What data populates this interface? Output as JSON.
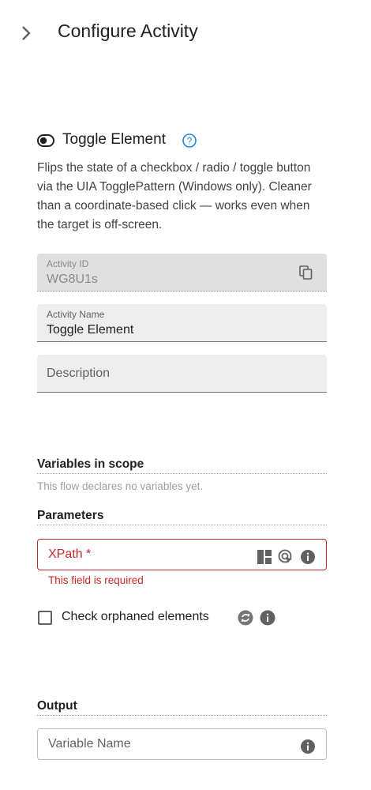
{
  "header": {
    "title": "Configure Activity",
    "expand_icon": "chevron-right-icon"
  },
  "activity": {
    "icon": "toggle-icon",
    "name": "Toggle Element",
    "help_icon": "help-circle-icon",
    "description": "Flips the state of a checkbox / radio / toggle button via the UIA TogglePattern (Windows only). Cleaner than a coordinate-based click — works even when the target is off-screen."
  },
  "fields": {
    "activity_id": {
      "label": "Activity ID",
      "value": "WG8U1s",
      "icon": "copy-icon"
    },
    "activity_name": {
      "label": "Activity Name",
      "value": "Toggle Element"
    },
    "description": {
      "placeholder": "Description"
    }
  },
  "variables": {
    "heading": "Variables in scope",
    "empty_text": "This flow declares no variables yet."
  },
  "parameters": {
    "heading": "Parameters",
    "xpath": {
      "placeholder": "XPath *",
      "error": "This field is required",
      "icons": [
        "layout-icon",
        "element-picker-icon",
        "info-icon"
      ]
    },
    "check_orphaned": {
      "label": "Check orphaned elements",
      "checked": false,
      "icons": [
        "toggle-expression-icon",
        "info-icon"
      ]
    }
  },
  "output": {
    "heading": "Output",
    "variable_placeholder": "Variable Name",
    "icon": "info-icon"
  },
  "colors": {
    "error": "#c62828",
    "accent": "#1e88e5",
    "icon_gray": "#616161"
  }
}
